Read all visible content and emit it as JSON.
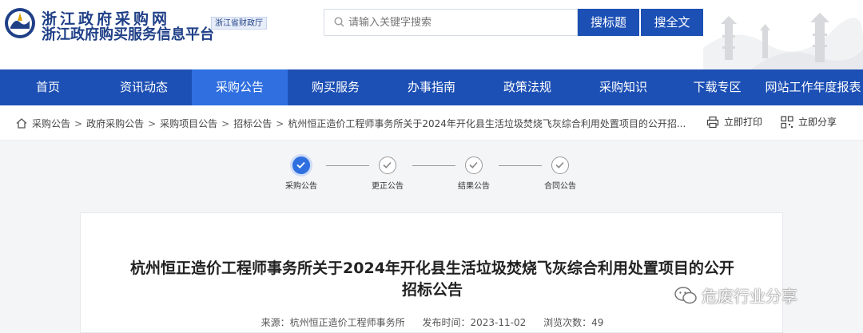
{
  "header": {
    "title_line1": "浙江政府采购网",
    "title_line2": "浙江政府购买服务信息平台",
    "dept_badge": "浙江省财政厅",
    "search_placeholder": "请输入关键字搜索",
    "btn_search_title": "搜标题",
    "btn_search_full": "搜全文"
  },
  "nav": {
    "items": [
      "首页",
      "资讯动态",
      "采购公告",
      "购买服务",
      "办事指南",
      "政策法规",
      "采购知识",
      "下载专区",
      "网站工作年度报表"
    ],
    "active": "采购公告"
  },
  "breadcrumb": {
    "items": [
      "采购公告",
      "政府采购公告",
      "采购项目公告",
      "招标公告",
      "杭州恒正造价工程师事务所关于2024年开化县生活垃圾焚烧飞灰综合利用处置项目的公开招..."
    ],
    "separator": ">",
    "print_label": "立即打印",
    "share_label": "立即分享"
  },
  "steps": [
    {
      "label": "采购公告",
      "status": "current"
    },
    {
      "label": "更正公告",
      "status": "done"
    },
    {
      "label": "结果公告",
      "status": "done"
    },
    {
      "label": "合同公告",
      "status": "done"
    }
  ],
  "document": {
    "title": "杭州恒正造价工程师事务所关于2024年开化县生活垃圾焚烧飞灰综合利用处置项目的公开招标公告",
    "source": "来源：杭州恒正造价工程师事务所",
    "publish_time": "发布时间：2023-11-02",
    "views": "浏览次数：49"
  },
  "watermark": "危废行业分享",
  "colors": {
    "brand_blue": "#1d50b5",
    "nav_active": "#2f6fe0"
  }
}
